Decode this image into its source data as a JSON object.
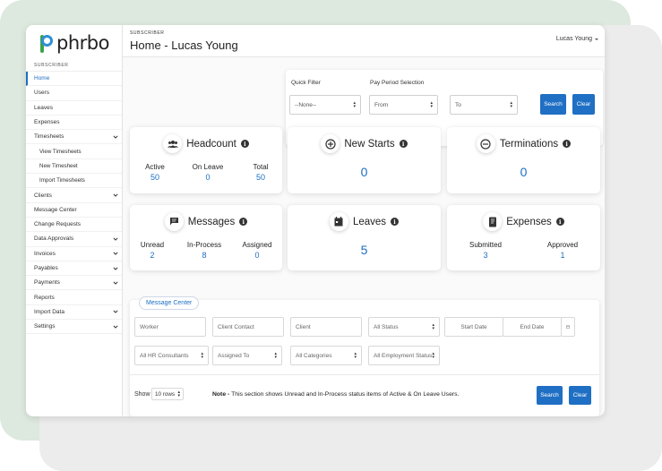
{
  "app": {
    "logo_text": "phrbo"
  },
  "header": {
    "section_label": "SUBSCRIBER",
    "title": "Home - Lucas Young",
    "user_name": "Lucas Young"
  },
  "sidebar": {
    "section_label": "SUBSCRIBER",
    "items": [
      {
        "label": "Home",
        "active": true
      },
      {
        "label": "Users"
      },
      {
        "label": "Leaves"
      },
      {
        "label": "Expenses"
      },
      {
        "label": "Timesheets",
        "expandable": true
      },
      {
        "label": "View Timesheets",
        "sub": true
      },
      {
        "label": "New Timesheet",
        "sub": true
      },
      {
        "label": "Import Timesheets",
        "sub": true
      },
      {
        "label": "Clients",
        "expandable": true
      },
      {
        "label": "Message Center"
      },
      {
        "label": "Change Requests"
      },
      {
        "label": "Data Approvals",
        "expandable": true
      },
      {
        "label": "Invoices",
        "expandable": true
      },
      {
        "label": "Payables",
        "expandable": true
      },
      {
        "label": "Payments",
        "expandable": true
      },
      {
        "label": "Reports"
      },
      {
        "label": "Import Data",
        "expandable": true
      },
      {
        "label": "Settings",
        "expandable": true
      }
    ]
  },
  "filters": {
    "quick_filter_label": "Quick Filter",
    "quick_filter_value": "--None--",
    "pay_period_label": "Pay Period Selection",
    "from_value": "From",
    "to_value": "To",
    "search_label": "Search",
    "clear_label": "Clear"
  },
  "cards": {
    "headcount": {
      "title": "Headcount",
      "stats": [
        {
          "label": "Active",
          "value": "50"
        },
        {
          "label": "On Leave",
          "value": "0"
        },
        {
          "label": "Total",
          "value": "50"
        }
      ]
    },
    "new_starts": {
      "title": "New Starts",
      "value": "0"
    },
    "terminations": {
      "title": "Terminations",
      "value": "0"
    },
    "messages": {
      "title": "Messages",
      "stats": [
        {
          "label": "Unread",
          "value": "2"
        },
        {
          "label": "In-Process",
          "value": "8"
        },
        {
          "label": "Assigned",
          "value": "0"
        }
      ]
    },
    "leaves": {
      "title": "Leaves",
      "value": "5"
    },
    "expenses": {
      "title": "Expenses",
      "stats": [
        {
          "label": "Submitted",
          "value": "3"
        },
        {
          "label": "Approved",
          "value": "1"
        }
      ]
    }
  },
  "message_center": {
    "tab_label": "Message Center",
    "worker_placeholder": "Worker",
    "client_contact_placeholder": "Client Contact",
    "client_placeholder": "Client",
    "status_value": "All Status",
    "start_date_placeholder": "Start Date",
    "end_date_placeholder": "End Date",
    "consultants_value": "All HR Consultants",
    "assigned_to_value": "Assigned To",
    "categories_value": "All Categories",
    "employment_status_value": "All Employment Status",
    "show_label": "Show",
    "rows_value": "10 rows",
    "note": "Note - This section shows Unread and In-Process status items of Active & On Leave Users.",
    "search_label": "Search",
    "clear_label": "Clear"
  },
  "colors": {
    "accent": "#1f6fc4",
    "logo_green": "#3aa34a",
    "logo_blue": "#2f8fd6"
  }
}
